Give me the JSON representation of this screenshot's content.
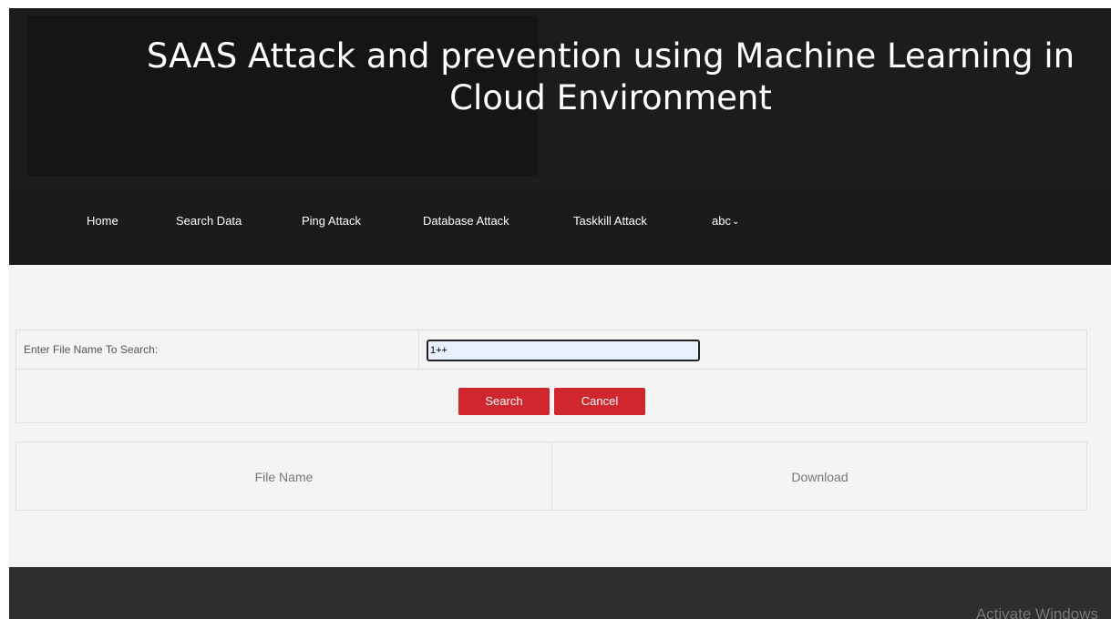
{
  "header": {
    "title": "SAAS Attack and prevention using Machine Learning in Cloud Environment"
  },
  "nav": {
    "items": [
      {
        "label": "Home"
      },
      {
        "label": "Search Data"
      },
      {
        "label": "Ping Attack"
      },
      {
        "label": "Database Attack"
      },
      {
        "label": "Taskkill Attack"
      },
      {
        "label": "abc"
      }
    ],
    "dropdown_icon": "chevron-down-icon"
  },
  "search_form": {
    "label": "Enter File Name To Search:",
    "input_value": "1++",
    "search_button": "Search",
    "cancel_button": "Cancel"
  },
  "results": {
    "columns": [
      "File Name",
      "Download"
    ]
  },
  "footer": {
    "watermark": "Activate Windows"
  },
  "colors": {
    "header_bg": "#1c1c1c",
    "page_bg": "#f4f4f4",
    "button_red": "#d0262d",
    "footer_bg": "#2e2e2e"
  }
}
